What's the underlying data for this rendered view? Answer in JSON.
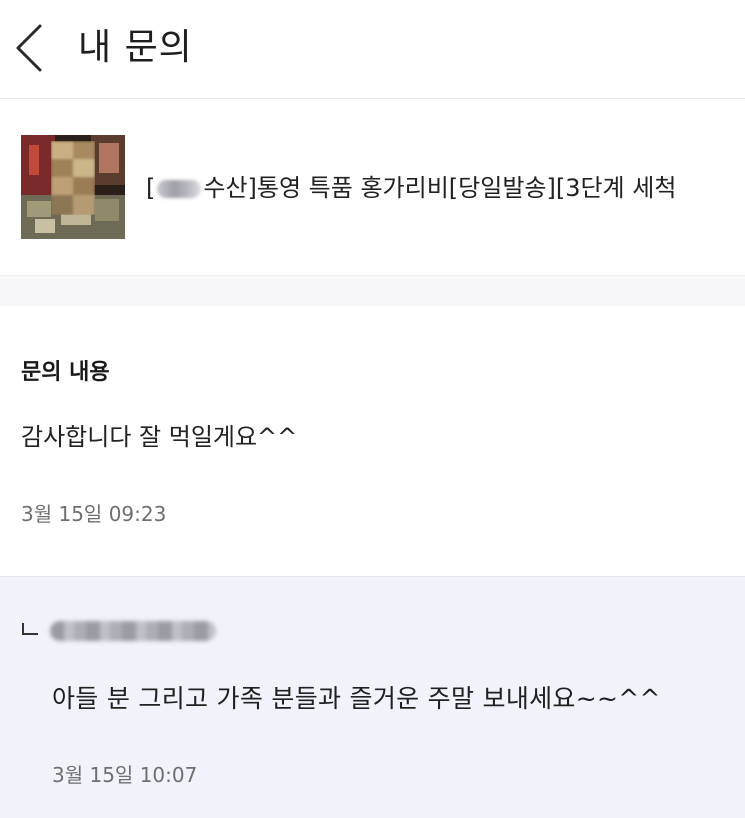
{
  "header": {
    "title": "내 문의",
    "back_icon": "chevron-left-icon"
  },
  "product": {
    "title_prefix": "[",
    "title_rest": "수산]통영 특품 홍가리비[당일발송][3단계 세척"
  },
  "inquiry": {
    "section_label": "문의 내용",
    "text": "감사합니다 잘 먹일게요^^",
    "timestamp": "3월 15일 09:23"
  },
  "reply": {
    "reply_icon": "reply-arrow-icon",
    "text": "아들 분 그리고 가족 분들과 즐거운 주말 보내세요~~^^",
    "timestamp": "3월 15일 10:07"
  },
  "colors": {
    "reply_background": "#f1f3fa",
    "timestamp_gray": "#6f6f6f",
    "divider": "#ebebeb"
  }
}
